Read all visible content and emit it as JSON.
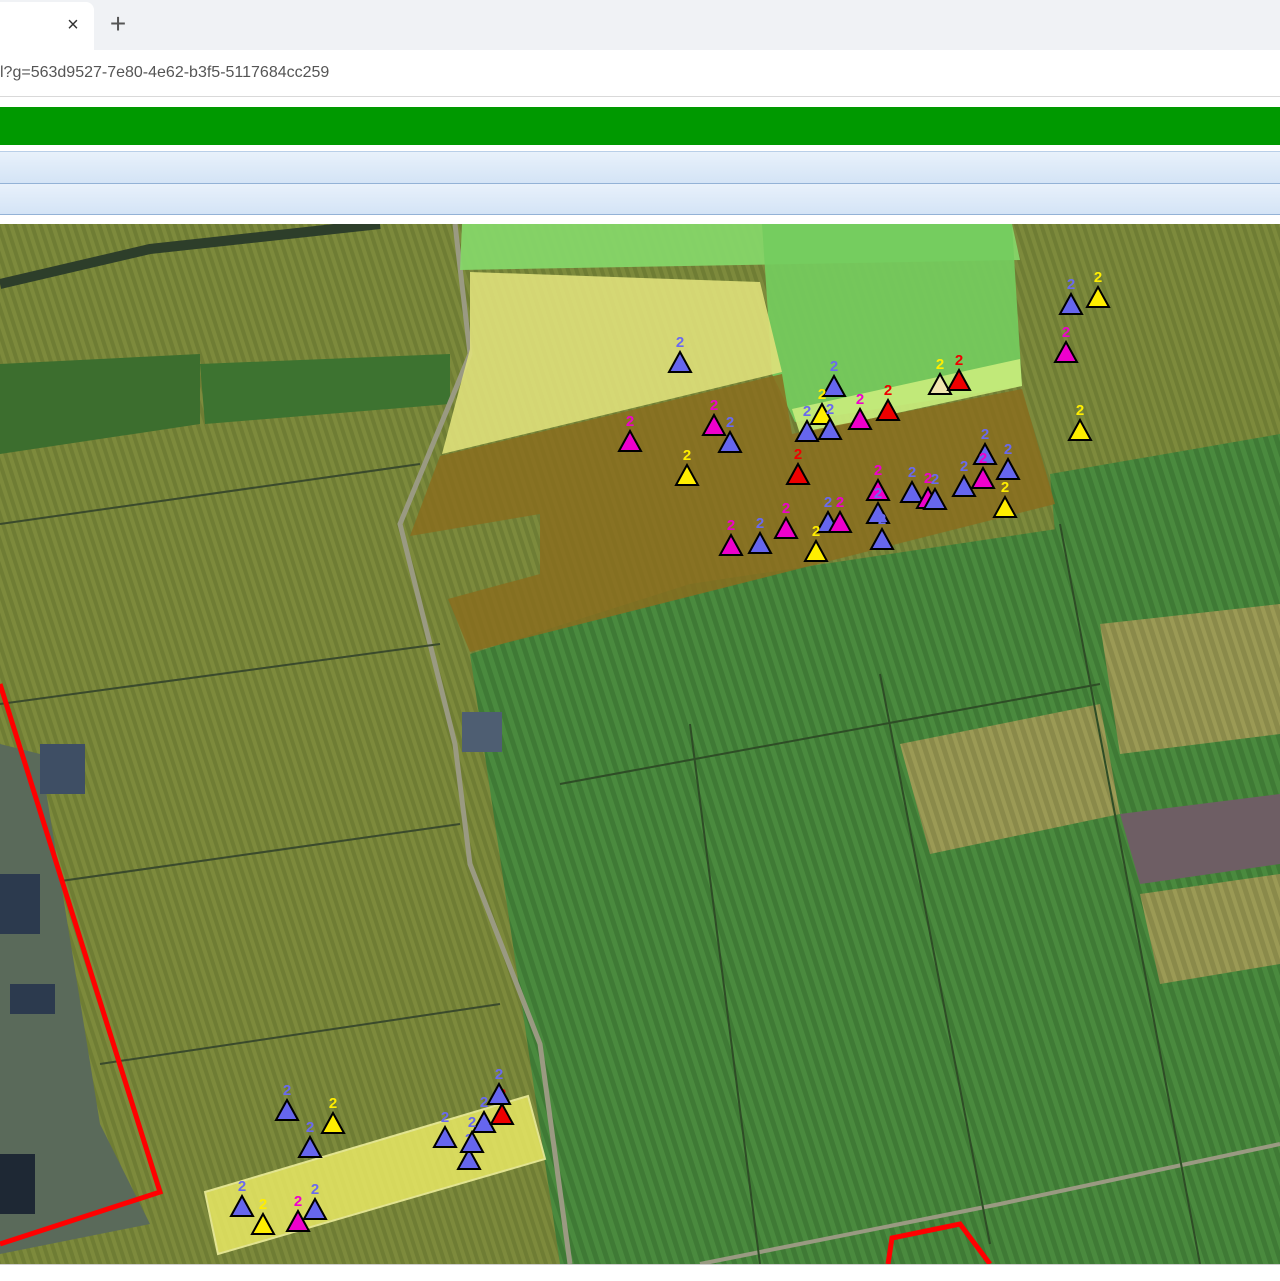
{
  "browser": {
    "tab_close_glyph": "×",
    "new_tab_glyph": "+",
    "url": "l?g=563d9527-7e80-4e62-b3f5-5117684cc259"
  },
  "colors": {
    "header_green": "#009900",
    "toolbar_blue": "#d4e4f6",
    "boundary_red": "#ff0000",
    "marker_blue": "#6666ee",
    "marker_magenta": "#ee00cc",
    "marker_yellow": "#ffee00",
    "marker_red": "#ee0000",
    "marker_beige": "#f0e6b0"
  },
  "map": {
    "type": "satellite imagery with field overlays",
    "markers": [
      {
        "label": "2",
        "color": "blue"
      },
      {
        "label": "2",
        "color": "yellow"
      },
      {
        "label": "2",
        "color": "magenta"
      },
      {
        "label": "2",
        "color": "yellow"
      },
      {
        "label": "2",
        "color": "blue"
      },
      {
        "label": "2",
        "color": "beige"
      },
      {
        "label": "2",
        "color": "red"
      },
      {
        "label": "2",
        "color": "blue"
      },
      {
        "label": "2",
        "color": "yellow"
      },
      {
        "label": "2",
        "color": "red"
      },
      {
        "label": "2",
        "color": "magenta"
      },
      {
        "label": "2",
        "color": "blue"
      },
      {
        "label": "2",
        "color": "blue"
      },
      {
        "label": "2",
        "color": "magenta"
      },
      {
        "label": "2",
        "color": "magenta"
      },
      {
        "label": "2",
        "color": "blue"
      },
      {
        "label": "2",
        "color": "yellow"
      },
      {
        "label": "2",
        "color": "red"
      },
      {
        "label": "2",
        "color": "blue"
      },
      {
        "label": "2",
        "color": "blue"
      },
      {
        "label": "2",
        "color": "blue"
      },
      {
        "label": "2",
        "color": "magenta"
      },
      {
        "label": "2",
        "color": "magenta"
      },
      {
        "label": "2",
        "color": "blue"
      },
      {
        "label": "2",
        "color": "blue"
      },
      {
        "label": "2",
        "color": "magenta"
      },
      {
        "label": "2",
        "color": "yellow"
      },
      {
        "label": "2",
        "color": "magenta"
      },
      {
        "label": "2",
        "color": "blue"
      },
      {
        "label": "2",
        "color": "magenta"
      },
      {
        "label": "2",
        "color": "blue"
      },
      {
        "label": "2",
        "color": "yellow"
      },
      {
        "label": "2",
        "color": "magenta"
      },
      {
        "label": "2",
        "color": "blue"
      },
      {
        "label": "2",
        "color": "blue"
      },
      {
        "label": "2",
        "color": "blue"
      },
      {
        "label": "2",
        "color": "yellow"
      },
      {
        "label": "2",
        "color": "blue"
      },
      {
        "label": "2",
        "color": "blue"
      },
      {
        "label": "2",
        "color": "blue"
      },
      {
        "label": "2",
        "color": "red"
      },
      {
        "label": "2",
        "color": "blue"
      },
      {
        "label": "2",
        "color": "blue"
      },
      {
        "label": "2",
        "color": "blue"
      },
      {
        "label": "2",
        "color": "blue"
      },
      {
        "label": "2",
        "color": "yellow"
      },
      {
        "label": "2",
        "color": "magenta"
      },
      {
        "label": "2",
        "color": "blue"
      }
    ]
  }
}
